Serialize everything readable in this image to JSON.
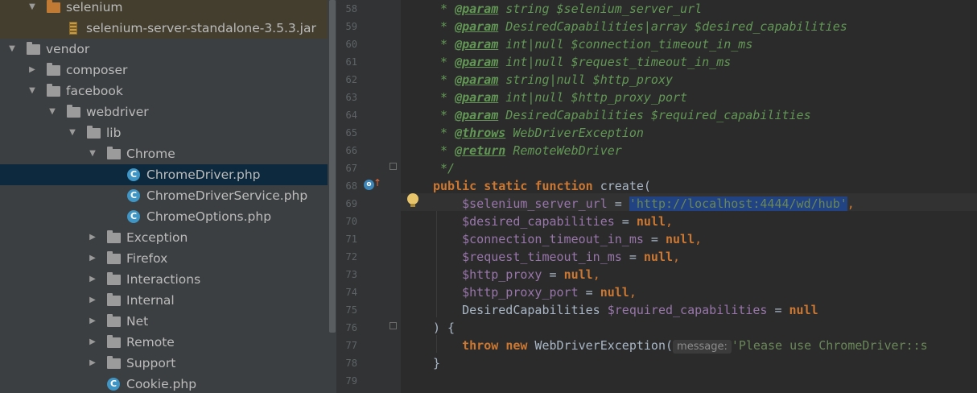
{
  "tree": {
    "nodes": [
      {
        "label": "selenium",
        "type": "folder",
        "level": 1,
        "expanded": true
      },
      {
        "label": "selenium-server-standalone-3.5.3.jar",
        "type": "jar",
        "level": 2,
        "expanded": null
      },
      {
        "label": "vendor",
        "type": "folder",
        "level": 0,
        "expanded": true
      },
      {
        "label": "composer",
        "type": "folder",
        "level": 1,
        "expanded": false
      },
      {
        "label": "facebook",
        "type": "folder",
        "level": 1,
        "expanded": true
      },
      {
        "label": "webdriver",
        "type": "folder",
        "level": 2,
        "expanded": true
      },
      {
        "label": "lib",
        "type": "folder",
        "level": 3,
        "expanded": true
      },
      {
        "label": "Chrome",
        "type": "folder",
        "level": 4,
        "expanded": true
      },
      {
        "label": "ChromeDriver.php",
        "type": "php-class",
        "level": 5,
        "expanded": null
      },
      {
        "label": "ChromeDriverService.php",
        "type": "php-class",
        "level": 5,
        "expanded": null
      },
      {
        "label": "ChromeOptions.php",
        "type": "php-class",
        "level": 5,
        "expanded": null
      },
      {
        "label": "Exception",
        "type": "folder",
        "level": 4,
        "expanded": false
      },
      {
        "label": "Firefox",
        "type": "folder",
        "level": 4,
        "expanded": false
      },
      {
        "label": "Interactions",
        "type": "folder",
        "level": 4,
        "expanded": false
      },
      {
        "label": "Internal",
        "type": "folder",
        "level": 4,
        "expanded": false
      },
      {
        "label": "Net",
        "type": "folder",
        "level": 4,
        "expanded": false
      },
      {
        "label": "Remote",
        "type": "folder",
        "level": 4,
        "expanded": false
      },
      {
        "label": "Support",
        "type": "folder",
        "level": 4,
        "expanded": false
      },
      {
        "label": "Cookie.php",
        "type": "php-class",
        "level": 4,
        "expanded": null
      }
    ],
    "selected_label": "ChromeDriver.php"
  },
  "editor": {
    "line_numbers": [
      "58",
      "59",
      "60",
      "61",
      "62",
      "63",
      "64",
      "65",
      "66",
      "67",
      "68",
      "69",
      "70",
      "71",
      "72",
      "73",
      "74",
      "75",
      "76",
      "77",
      "78",
      "79"
    ],
    "doc": {
      "l58": {
        "star": " * ",
        "tag": "@param",
        "type": " string ",
        "var": "$selenium_server_url"
      },
      "l59": {
        "star": " * ",
        "tag": "@param",
        "type": " DesiredCapabilities|array ",
        "var": "$desired_capabilities"
      },
      "l60": {
        "star": " * ",
        "tag": "@param",
        "type": " int|null ",
        "var": "$connection_timeout_in_ms"
      },
      "l61": {
        "star": " * ",
        "tag": "@param",
        "type": " int|null ",
        "var": "$request_timeout_in_ms"
      },
      "l62": {
        "star": " * ",
        "tag": "@param",
        "type": " string|null ",
        "var": "$http_proxy"
      },
      "l63": {
        "star": " * ",
        "tag": "@param",
        "type": " int|null ",
        "var": "$http_proxy_port"
      },
      "l64": {
        "star": " * ",
        "tag": "@param",
        "type": " DesiredCapabilities ",
        "var": "$required_capabilities"
      },
      "l65": {
        "star": " * ",
        "tag": "@throws",
        "type": " WebDriverException"
      },
      "l66": {
        "star": " * ",
        "tag": "@return",
        "type": " RemoteWebDriver"
      },
      "l67": " */"
    },
    "code": {
      "kw_public": "public",
      "kw_static": "static",
      "kw_function": "function",
      "fn_name": "create(",
      "p1_var": "$selenium_server_url",
      "p1_eq": " = ",
      "p1_val": "'http://localhost:4444/wd/hub'",
      "p2_var": "$desired_capabilities",
      "p3_var": "$connection_timeout_in_ms",
      "p4_var": "$request_timeout_in_ms",
      "p5_var": "$http_proxy",
      "p6_var": "$http_proxy_port",
      "p7_type": "DesiredCapabilities ",
      "p7_var": "$required_capabilities",
      "eq": " = ",
      "null": "null",
      "comma": ",",
      "close_paren": ") {",
      "kw_throw": "throw",
      "kw_new": "new",
      "exc_class": " WebDriverException(",
      "hint": "message:",
      "exc_msg": "'Please use ChromeDriver::s",
      "close_brace": "}"
    }
  },
  "colors": {
    "keyword": "#cc7832",
    "variable": "#9876aa",
    "string": "#6a8759",
    "doc": "#629755",
    "text": "#a9b7c6"
  }
}
